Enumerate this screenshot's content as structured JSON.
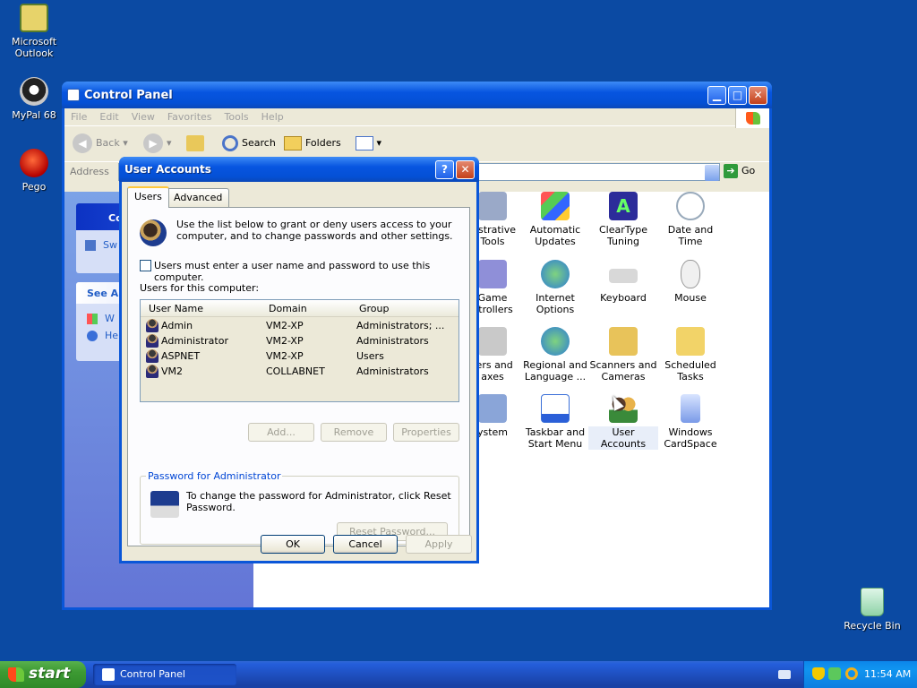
{
  "desktop": {
    "icons": [
      {
        "label": "Microsoft\nOutlook"
      },
      {
        "label": "MyPal 68"
      },
      {
        "label": "Pego"
      },
      {
        "label": "Recycle Bin"
      }
    ]
  },
  "control_panel": {
    "title": "Control Panel",
    "menu": [
      "File",
      "Edit",
      "View",
      "Favorites",
      "Tools",
      "Help"
    ],
    "toolbar": {
      "back": "Back",
      "search": "Search",
      "folders": "Folders"
    },
    "address_label": "Address",
    "go_label": "Go",
    "left_pane": {
      "box1_header": "Co",
      "box1_item": "Sw",
      "box2_header": "See Al",
      "box2_item1": "W",
      "box2_item2": "He"
    },
    "icons": [
      {
        "label": "nistrative\nTools"
      },
      {
        "label": "Automatic\nUpdates"
      },
      {
        "label": "ClearType\nTuning"
      },
      {
        "label": "Date and Time"
      },
      {
        "label": "Game\nntrollers"
      },
      {
        "label": "Internet\nOptions"
      },
      {
        "label": "Keyboard"
      },
      {
        "label": "Mouse"
      },
      {
        "label": "ters and\naxes"
      },
      {
        "label": "Regional and\nLanguage ..."
      },
      {
        "label": "Scanners and\nCameras"
      },
      {
        "label": "Scheduled\nTasks"
      },
      {
        "label": "ystem"
      },
      {
        "label": "Taskbar and\nStart Menu"
      },
      {
        "label": "User Accounts"
      },
      {
        "label": "Windows\nCardSpace"
      }
    ]
  },
  "user_accounts": {
    "title": "User Accounts",
    "help_glyph": "?",
    "close_glyph": "✕",
    "tabs": [
      "Users",
      "Advanced"
    ],
    "intro": "Use the list below to grant or deny users access to your computer, and to change passwords and other settings.",
    "checkbox_label": "Users must enter a user name and password to use this computer.",
    "list_caption": "Users for this computer:",
    "columns": [
      "User Name",
      "Domain",
      "Group"
    ],
    "users": [
      {
        "name": "Admin",
        "domain": "VM2-XP",
        "group": "Administrators; ..."
      },
      {
        "name": "Administrator",
        "domain": "VM2-XP",
        "group": "Administrators"
      },
      {
        "name": "ASPNET",
        "domain": "VM2-XP",
        "group": "Users"
      },
      {
        "name": "VM2",
        "domain": "COLLABNET",
        "group": "Administrators"
      }
    ],
    "buttons": {
      "add": "Add...",
      "remove": "Remove",
      "properties": "Properties",
      "reset": "Reset Password...",
      "ok": "OK",
      "cancel": "Cancel",
      "apply": "Apply"
    },
    "password_group": {
      "legend": "Password for Administrator",
      "text": "To change the password for Administrator, click Reset Password."
    }
  },
  "taskbar": {
    "start_label": "start",
    "task_label": "Control Panel",
    "clock": "11:54 AM"
  }
}
